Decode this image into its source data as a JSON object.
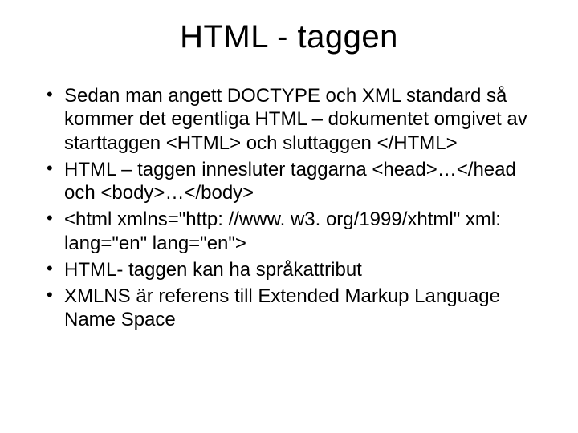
{
  "title": "HTML - taggen",
  "bullets": [
    "Sedan man angett DOCTYPE och XML standard så kommer det egentliga HTML – dokumentet omgivet av starttaggen <HTML> och sluttaggen </HTML>",
    "HTML – taggen innesluter taggarna <head>…</head och <body>…</body>",
    "<html xmlns=\"http: //www. w3. org/1999/xhtml\" xml: lang=\"en\" lang=\"en\">",
    "HTML- taggen kan ha språkattribut",
    "XMLNS är referens till Extended Markup Language Name Space"
  ]
}
